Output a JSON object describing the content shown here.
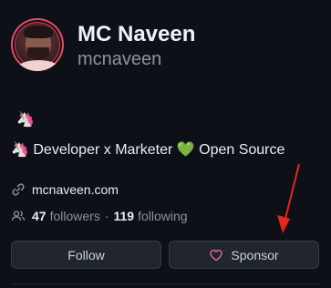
{
  "profile": {
    "name": "MC Naveen",
    "username": "mcnaveen",
    "status_emoji": "🦄",
    "bio": "🦄 Developer x Marketer 💚 Open Source",
    "website": "mcnaveen.com",
    "followers_count": "47",
    "followers_label": "followers",
    "separator": "·",
    "following_count": "119",
    "following_label": "following"
  },
  "actions": {
    "follow_label": "Follow",
    "sponsor_label": "Sponsor"
  },
  "colors": {
    "background": "#0d1117",
    "button_bg": "#21262d",
    "sponsor_heart": "#db61a2",
    "annotation_arrow": "#e5261c"
  },
  "icons": {
    "website": "link-icon",
    "followers": "people-icon",
    "sponsor": "heart-icon"
  }
}
